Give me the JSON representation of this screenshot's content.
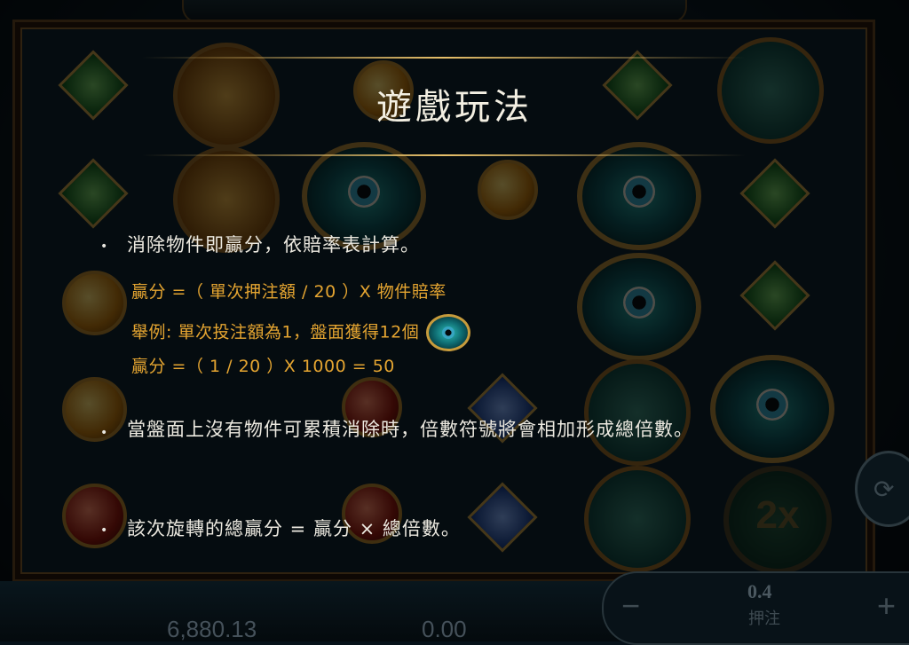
{
  "help": {
    "title": "遊戲玩法",
    "rules": [
      {
        "text": "消除物件即贏分，依賠率表計算。"
      },
      {
        "text": "當盤面上沒有物件可累積消除時，倍數符號將會相加形成總倍數。"
      },
      {
        "text": "該次旋轉的總贏分 = 贏分 × 總倍數。"
      }
    ],
    "formula": {
      "line1": "贏分 =（ 單次押注額 / 20 ）X 物件賠率",
      "line2": "舉例: 單次投注額為1，盤面獲得12個",
      "line3": "贏分 =（ 1 / 20 ）X 1000 = 50",
      "example_icon": "eye-of-horus-icon"
    }
  },
  "background": {
    "multiplier_symbol": "2x"
  },
  "bottom_bar": {
    "balance": "6,880.13",
    "win": "0.00",
    "bet_value": "0.4",
    "bet_label": "押注",
    "minus_label": "−",
    "plus_label": "+",
    "autoplay_icon": "⟳"
  },
  "colors": {
    "accent_gold": "#e5a531",
    "text_light": "#ece9e0"
  }
}
